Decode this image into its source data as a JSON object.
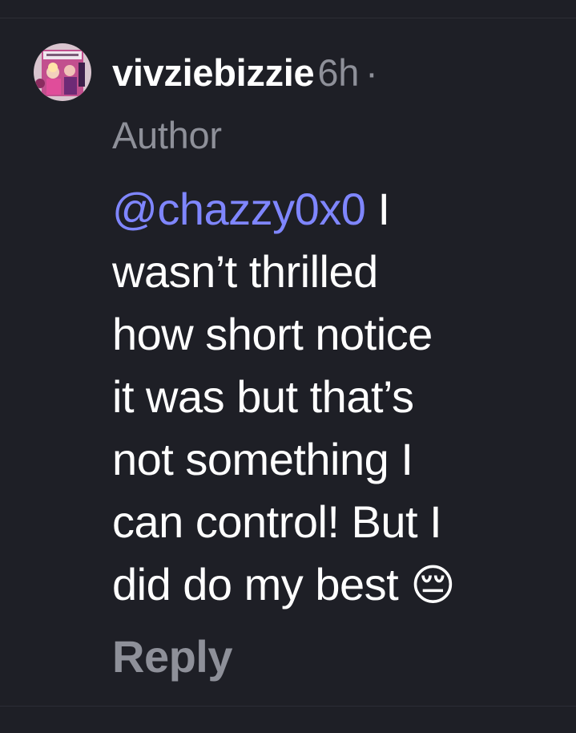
{
  "comment": {
    "avatar_icon": "user-avatar-photo",
    "username": "vivziebizzie",
    "timestamp": "6h",
    "separator": "·",
    "author_badge": "Author",
    "mention": "@chazzy0x0",
    "text_lines": [
      " I",
      "wasn’t thrilled",
      "how short notice",
      "it was but that’s",
      "not something I",
      "can control! But I",
      "did do my best "
    ],
    "emoji": "😔",
    "reply_label": "Reply"
  },
  "colors": {
    "background": "#1e1f26",
    "text_primary": "#ffffff",
    "text_secondary": "#8e9099",
    "mention": "#7f86ff"
  }
}
